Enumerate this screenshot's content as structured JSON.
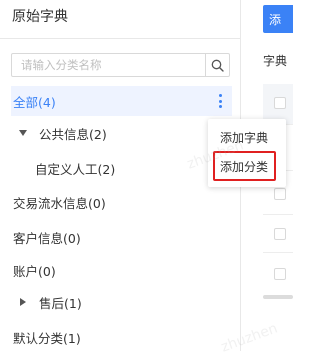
{
  "panel": {
    "title": "原始字典",
    "search_placeholder": "请输入分类名称"
  },
  "tree": {
    "items": [
      {
        "label": "全部(4)",
        "selected": true
      },
      {
        "label": "公共信息(2)",
        "expanded": true
      },
      {
        "label": "自定义人工(2)"
      },
      {
        "label": "交易流水信息(0)"
      },
      {
        "label": "客户信息(0)"
      },
      {
        "label": "账户(0)"
      },
      {
        "label": "售后(1)",
        "expanded": false
      },
      {
        "label": "默认分类(1)"
      }
    ]
  },
  "context_menu": {
    "items": [
      {
        "label": "添加字典"
      },
      {
        "label": "添加分类",
        "highlighted": true
      }
    ]
  },
  "right": {
    "add_button_label": "添",
    "dict_label": "字典"
  },
  "colors": {
    "accent": "#3b82f6",
    "selected_bg": "#eef3ff",
    "highlight_border": "#e02020"
  },
  "watermark": "zhuzhen"
}
